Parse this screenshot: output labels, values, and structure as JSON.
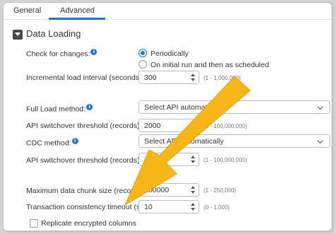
{
  "tabs": [
    {
      "label": "General"
    },
    {
      "label": "Advanced"
    }
  ],
  "section": {
    "title": "Data Loading"
  },
  "check_for_changes": {
    "label": "Check for changes:",
    "options": [
      "Periodically",
      "On initial run and then as scheduled"
    ],
    "selected": "Periodically"
  },
  "incremental_load_interval": {
    "label": "Incremental load interval (seconds):",
    "value": "300",
    "range": "(1 - 1,000,000)"
  },
  "full_load_method": {
    "label": "Full Load method:",
    "value": "Select API automatically"
  },
  "api_switchover_1": {
    "label": "API switchover threshold (records):",
    "value": "2000",
    "range": "(1 - 100,000,000)"
  },
  "cdc_method": {
    "label": "CDC method:",
    "value": "Select API automatically"
  },
  "api_switchover_2": {
    "label": "API switchover threshold (records):",
    "value": "",
    "range": "(1 - 100,000,000)"
  },
  "max_chunk_size": {
    "label": "Maximum data chunk size (records):",
    "value": "100000",
    "range": "(1 - 250,000)"
  },
  "transaction_timeout": {
    "label": "Transaction consistency timeout (sec.):",
    "value": "10",
    "range": "(0 - 1,000)"
  },
  "replicate_encrypted": {
    "label": "Replicate encrypted columns",
    "checked": false
  },
  "icons": {
    "info": "info-icon",
    "collapse": "chevron-down-icon",
    "annotation": "arrow-annotation"
  },
  "colors": {
    "accent": "#1f78d1",
    "arrow": "#f7b719"
  }
}
